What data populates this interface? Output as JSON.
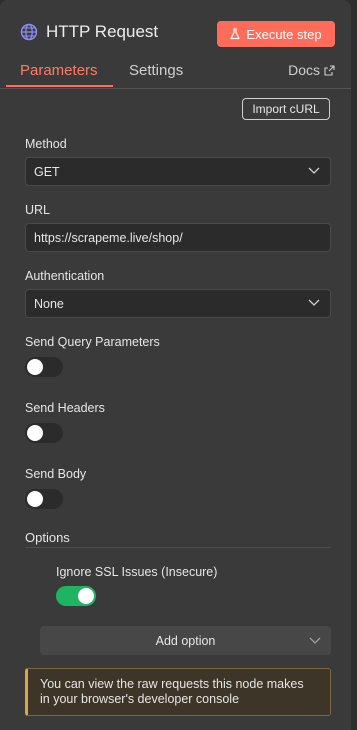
{
  "header": {
    "title": "HTTP Request",
    "icon": "globe-icon",
    "execute_label": "Execute step",
    "execute_icon": "flask-icon",
    "accent_color": "#ff6d5a"
  },
  "tabs": [
    {
      "label": "Parameters",
      "active": true
    },
    {
      "label": "Settings",
      "active": false
    }
  ],
  "docs": {
    "label": "Docs",
    "icon": "external-link-icon"
  },
  "import_curl_label": "Import cURL",
  "method": {
    "label": "Method",
    "value": "GET"
  },
  "url": {
    "label": "URL",
    "value": "https://scrapeme.live/shop/"
  },
  "authentication": {
    "label": "Authentication",
    "value": "None"
  },
  "send_query": {
    "label": "Send Query Parameters",
    "on": false
  },
  "send_headers": {
    "label": "Send Headers",
    "on": false
  },
  "send_body": {
    "label": "Send Body",
    "on": false
  },
  "options": {
    "title": "Options",
    "ignore_ssl": {
      "label": "Ignore SSL Issues (Insecure)",
      "on": true,
      "color": "#1fb462"
    },
    "add_option_label": "Add option"
  },
  "notice": {
    "line1": "You can view the raw requests this node makes",
    "line2": "in your browser's developer console"
  }
}
